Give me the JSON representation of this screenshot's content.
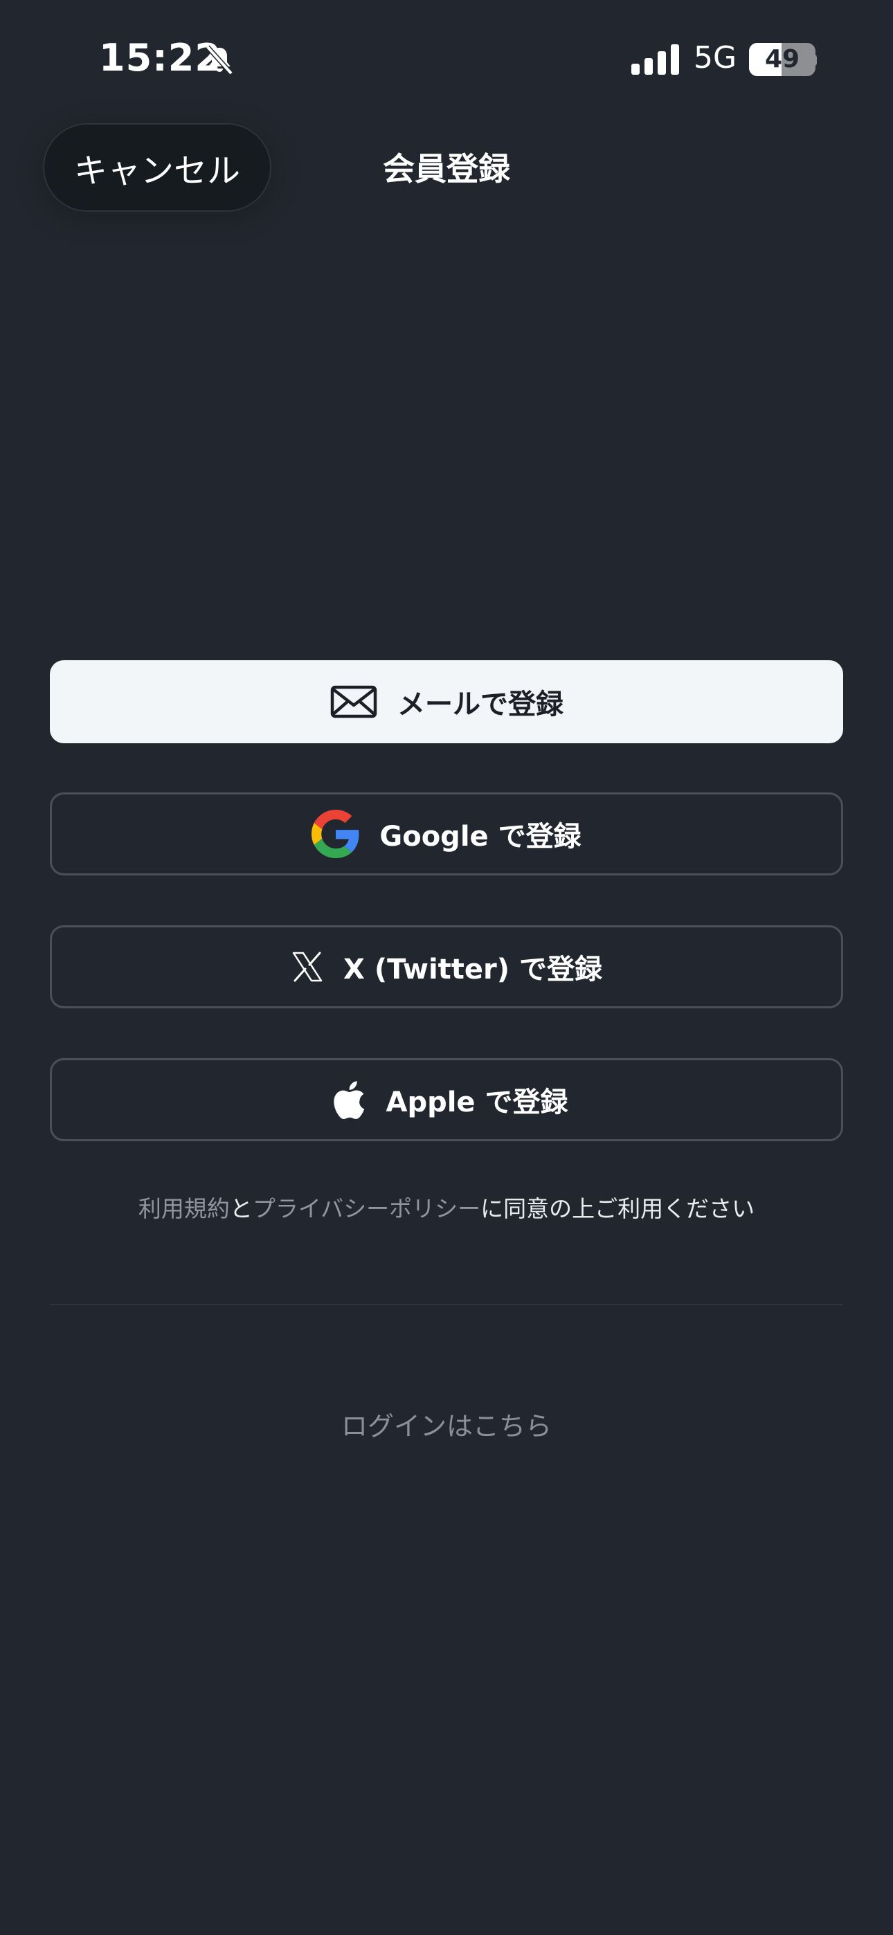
{
  "status_bar": {
    "time": "15:22",
    "network": "5G",
    "battery": "49",
    "battery_fraction": 0.49,
    "silent_icon": "bell-slash-icon",
    "signal_icon": "cellular-signal-icon"
  },
  "header": {
    "cancel_label": "キャンセル",
    "title": "会員登録"
  },
  "signup_options": {
    "email": {
      "label": "メールで登録",
      "icon": "mail-icon"
    },
    "google": {
      "label": "Google で登録",
      "icon": "google-icon"
    },
    "x": {
      "label": "X (Twitter) で登録",
      "icon": "x-logo-icon"
    },
    "apple": {
      "label": "Apple で登録",
      "icon": "apple-icon"
    }
  },
  "terms": {
    "terms_link": "利用規約",
    "and": "と",
    "privacy_link": "プライバシーポリシー",
    "suffix": "に同意の上ご利用ください"
  },
  "login_link": "ログインはこちら",
  "colors": {
    "background": "#22272f",
    "primary_button": "#f3f6f9",
    "outline_border": "#4a5058",
    "link_muted": "#8f96a0"
  }
}
